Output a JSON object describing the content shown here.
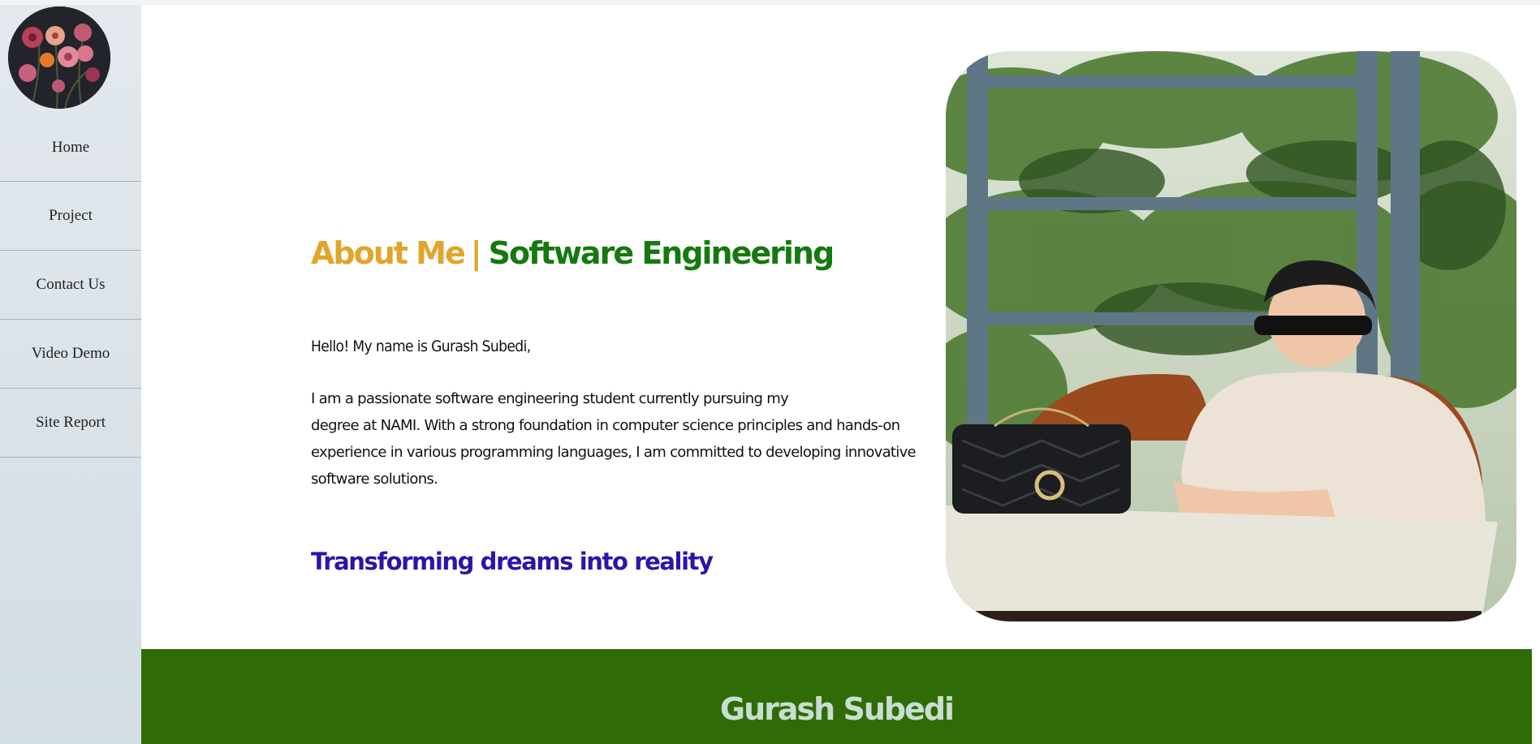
{
  "sidebar": {
    "items": [
      {
        "label": "Home"
      },
      {
        "label": "Project"
      },
      {
        "label": "Contact Us"
      },
      {
        "label": "Video Demo"
      },
      {
        "label": "Site Report"
      }
    ]
  },
  "about": {
    "title_about": "About Me",
    "separator": "|",
    "title_field": "Software Engineering",
    "greeting": "Hello! My name is Gurash Subedi,",
    "intro_line1": "I am a passionate software engineering student currently pursuing my",
    "intro_rest": "degree at NAMI. With a strong foundation in computer science principles and hands-on experience in various programming languages, I am committed to developing innovative software solutions.",
    "tagline": "Transforming dreams into reality"
  },
  "footer": {
    "name": "Gurash Subedi"
  },
  "colors": {
    "about_accent": "#e0a52a",
    "field_accent": "#16790f",
    "tagline": "#2a16a8",
    "footer_bg": "#2f6b06",
    "footer_text": "#c9ddd0"
  }
}
